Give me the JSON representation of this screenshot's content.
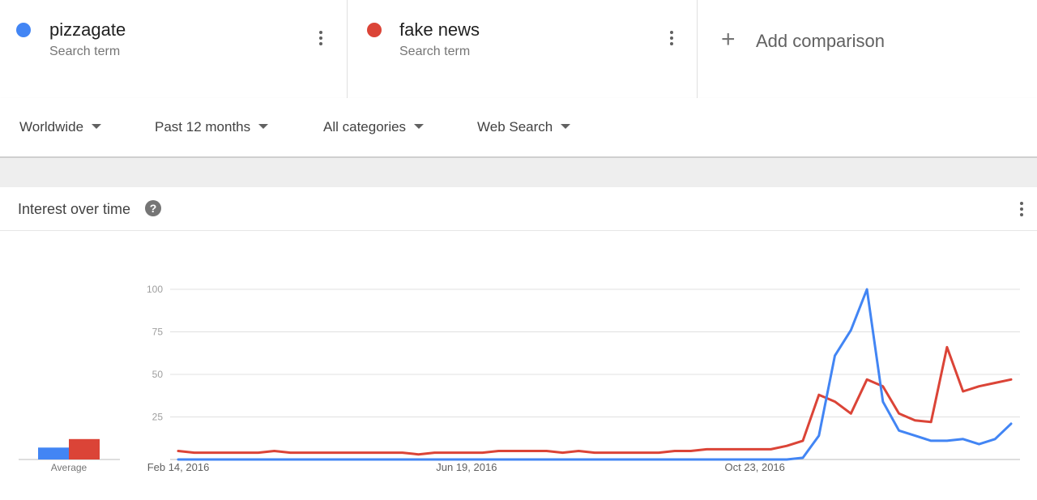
{
  "search_terms": [
    {
      "name": "pizzagate",
      "subtitle": "Search term",
      "color": "#4285f4"
    },
    {
      "name": "fake news",
      "subtitle": "Search term",
      "color": "#db4437"
    }
  ],
  "add_comparison": {
    "label": "Add comparison",
    "icon": "plus-icon"
  },
  "filters": {
    "region": "Worldwide",
    "time_range": "Past 12 months",
    "category": "All categories",
    "search_type": "Web Search"
  },
  "card": {
    "title": "Interest over time",
    "help_icon": "?",
    "menu_icon": "more-vert-icon"
  },
  "chart_data": {
    "type": "line",
    "title": "Interest over time",
    "ylim": [
      0,
      100
    ],
    "y_ticks": [
      "100",
      "75",
      "50",
      "25"
    ],
    "x_tick_labels": [
      "Feb 14, 2016",
      "Jun 19, 2016",
      "Oct 23, 2016"
    ],
    "average_label": "Average",
    "averages": [
      {
        "name": "pizzagate",
        "value": 7
      },
      {
        "name": "fake news",
        "value": 12
      }
    ],
    "series": [
      {
        "name": "pizzagate",
        "color": "#4285f4",
        "values": [
          0,
          0,
          0,
          0,
          0,
          0,
          0,
          0,
          0,
          0,
          0,
          0,
          0,
          0,
          0,
          0,
          0,
          0,
          0,
          0,
          0,
          0,
          0,
          0,
          0,
          0,
          0,
          0,
          0,
          0,
          0,
          0,
          0,
          0,
          0,
          0,
          0,
          0,
          0,
          1,
          14,
          61,
          76,
          100,
          34,
          17,
          14,
          11,
          11,
          12,
          9,
          12,
          21
        ]
      },
      {
        "name": "fake news",
        "color": "#db4437",
        "values": [
          5,
          4,
          4,
          4,
          4,
          4,
          5,
          4,
          4,
          4,
          4,
          4,
          4,
          4,
          4,
          3,
          4,
          4,
          4,
          4,
          5,
          5,
          5,
          5,
          4,
          5,
          4,
          4,
          4,
          4,
          4,
          5,
          5,
          6,
          6,
          6,
          6,
          6,
          8,
          11,
          38,
          34,
          27,
          47,
          43,
          27,
          23,
          22,
          66,
          40,
          43,
          45,
          47
        ]
      }
    ]
  }
}
